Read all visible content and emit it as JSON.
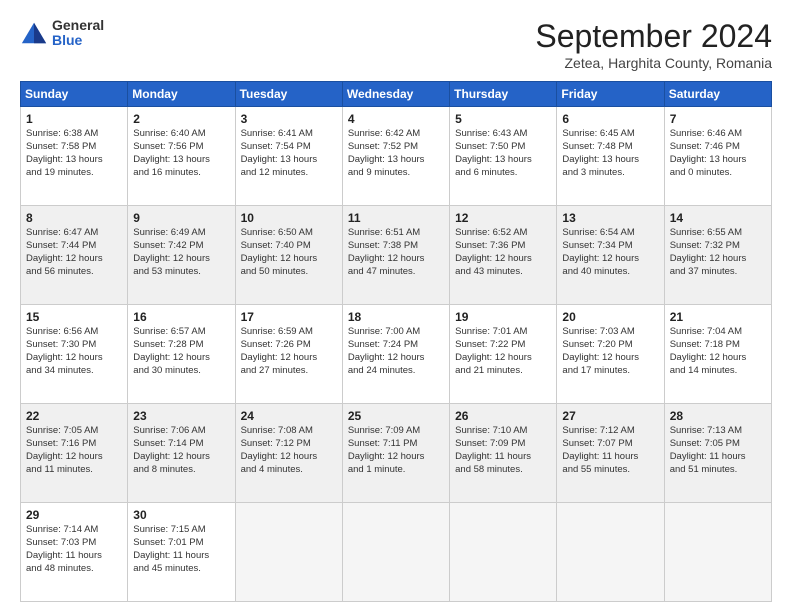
{
  "logo": {
    "general": "General",
    "blue": "Blue"
  },
  "title": "September 2024",
  "subtitle": "Zetea, Harghita County, Romania",
  "days": [
    "Sunday",
    "Monday",
    "Tuesday",
    "Wednesday",
    "Thursday",
    "Friday",
    "Saturday"
  ],
  "weeks": [
    [
      {
        "day": "1",
        "info": "Sunrise: 6:38 AM\nSunset: 7:58 PM\nDaylight: 13 hours\nand 19 minutes."
      },
      {
        "day": "2",
        "info": "Sunrise: 6:40 AM\nSunset: 7:56 PM\nDaylight: 13 hours\nand 16 minutes."
      },
      {
        "day": "3",
        "info": "Sunrise: 6:41 AM\nSunset: 7:54 PM\nDaylight: 13 hours\nand 12 minutes."
      },
      {
        "day": "4",
        "info": "Sunrise: 6:42 AM\nSunset: 7:52 PM\nDaylight: 13 hours\nand 9 minutes."
      },
      {
        "day": "5",
        "info": "Sunrise: 6:43 AM\nSunset: 7:50 PM\nDaylight: 13 hours\nand 6 minutes."
      },
      {
        "day": "6",
        "info": "Sunrise: 6:45 AM\nSunset: 7:48 PM\nDaylight: 13 hours\nand 3 minutes."
      },
      {
        "day": "7",
        "info": "Sunrise: 6:46 AM\nSunset: 7:46 PM\nDaylight: 13 hours\nand 0 minutes."
      }
    ],
    [
      {
        "day": "8",
        "info": "Sunrise: 6:47 AM\nSunset: 7:44 PM\nDaylight: 12 hours\nand 56 minutes."
      },
      {
        "day": "9",
        "info": "Sunrise: 6:49 AM\nSunset: 7:42 PM\nDaylight: 12 hours\nand 53 minutes."
      },
      {
        "day": "10",
        "info": "Sunrise: 6:50 AM\nSunset: 7:40 PM\nDaylight: 12 hours\nand 50 minutes."
      },
      {
        "day": "11",
        "info": "Sunrise: 6:51 AM\nSunset: 7:38 PM\nDaylight: 12 hours\nand 47 minutes."
      },
      {
        "day": "12",
        "info": "Sunrise: 6:52 AM\nSunset: 7:36 PM\nDaylight: 12 hours\nand 43 minutes."
      },
      {
        "day": "13",
        "info": "Sunrise: 6:54 AM\nSunset: 7:34 PM\nDaylight: 12 hours\nand 40 minutes."
      },
      {
        "day": "14",
        "info": "Sunrise: 6:55 AM\nSunset: 7:32 PM\nDaylight: 12 hours\nand 37 minutes."
      }
    ],
    [
      {
        "day": "15",
        "info": "Sunrise: 6:56 AM\nSunset: 7:30 PM\nDaylight: 12 hours\nand 34 minutes."
      },
      {
        "day": "16",
        "info": "Sunrise: 6:57 AM\nSunset: 7:28 PM\nDaylight: 12 hours\nand 30 minutes."
      },
      {
        "day": "17",
        "info": "Sunrise: 6:59 AM\nSunset: 7:26 PM\nDaylight: 12 hours\nand 27 minutes."
      },
      {
        "day": "18",
        "info": "Sunrise: 7:00 AM\nSunset: 7:24 PM\nDaylight: 12 hours\nand 24 minutes."
      },
      {
        "day": "19",
        "info": "Sunrise: 7:01 AM\nSunset: 7:22 PM\nDaylight: 12 hours\nand 21 minutes."
      },
      {
        "day": "20",
        "info": "Sunrise: 7:03 AM\nSunset: 7:20 PM\nDaylight: 12 hours\nand 17 minutes."
      },
      {
        "day": "21",
        "info": "Sunrise: 7:04 AM\nSunset: 7:18 PM\nDaylight: 12 hours\nand 14 minutes."
      }
    ],
    [
      {
        "day": "22",
        "info": "Sunrise: 7:05 AM\nSunset: 7:16 PM\nDaylight: 12 hours\nand 11 minutes."
      },
      {
        "day": "23",
        "info": "Sunrise: 7:06 AM\nSunset: 7:14 PM\nDaylight: 12 hours\nand 8 minutes."
      },
      {
        "day": "24",
        "info": "Sunrise: 7:08 AM\nSunset: 7:12 PM\nDaylight: 12 hours\nand 4 minutes."
      },
      {
        "day": "25",
        "info": "Sunrise: 7:09 AM\nSunset: 7:11 PM\nDaylight: 12 hours\nand 1 minute."
      },
      {
        "day": "26",
        "info": "Sunrise: 7:10 AM\nSunset: 7:09 PM\nDaylight: 11 hours\nand 58 minutes."
      },
      {
        "day": "27",
        "info": "Sunrise: 7:12 AM\nSunset: 7:07 PM\nDaylight: 11 hours\nand 55 minutes."
      },
      {
        "day": "28",
        "info": "Sunrise: 7:13 AM\nSunset: 7:05 PM\nDaylight: 11 hours\nand 51 minutes."
      }
    ],
    [
      {
        "day": "29",
        "info": "Sunrise: 7:14 AM\nSunset: 7:03 PM\nDaylight: 11 hours\nand 48 minutes."
      },
      {
        "day": "30",
        "info": "Sunrise: 7:15 AM\nSunset: 7:01 PM\nDaylight: 11 hours\nand 45 minutes."
      },
      {
        "day": "",
        "info": ""
      },
      {
        "day": "",
        "info": ""
      },
      {
        "day": "",
        "info": ""
      },
      {
        "day": "",
        "info": ""
      },
      {
        "day": "",
        "info": ""
      }
    ]
  ]
}
